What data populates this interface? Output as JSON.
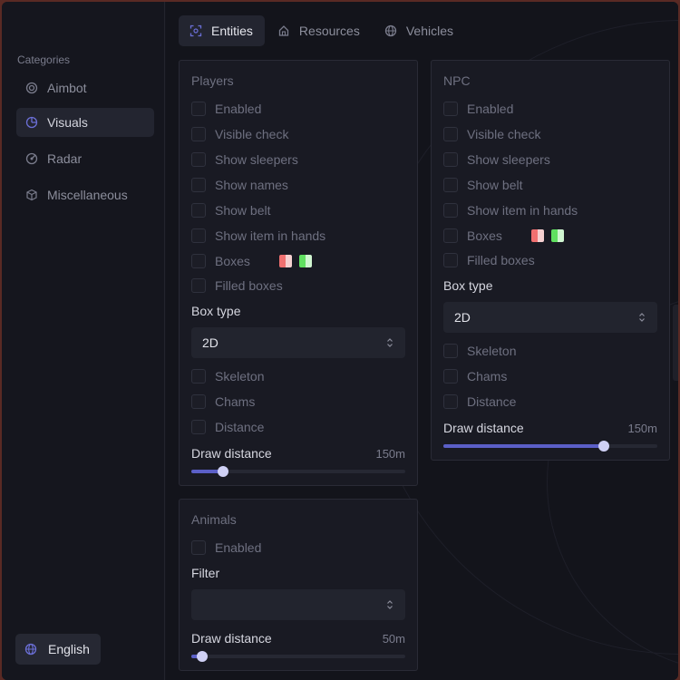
{
  "sidebar": {
    "heading": "Categories",
    "items": [
      {
        "label": "Aimbot",
        "icon": "target-icon",
        "active": false
      },
      {
        "label": "Visuals",
        "icon": "pie-chart-icon",
        "active": true
      },
      {
        "label": "Radar",
        "icon": "radar-icon",
        "active": false
      },
      {
        "label": "Miscellaneous",
        "icon": "cube-icon",
        "active": false
      }
    ],
    "language": {
      "label": "English",
      "icon": "globe-icon"
    }
  },
  "tabs": [
    {
      "label": "Entities",
      "icon": "scan-icon",
      "active": true
    },
    {
      "label": "Resources",
      "icon": "home-icon",
      "active": false
    },
    {
      "label": "Vehicles",
      "icon": "globe-icon",
      "active": false
    }
  ],
  "players": {
    "title": "Players",
    "checks_top": [
      "Enabled",
      "Visible check",
      "Show sleepers",
      "Show names",
      "Show belt",
      "Show item in hands",
      "Boxes",
      "Filled boxes"
    ],
    "box_type_label": "Box type",
    "box_type_value": "2D",
    "checks_bottom": [
      "Skeleton",
      "Chams",
      "Distance"
    ],
    "slider": {
      "label": "Draw distance",
      "value": "150m",
      "fraction": 0.15
    },
    "colors": {
      "box_color_a": "#f07070",
      "box_color_b": "#60e060"
    }
  },
  "npc": {
    "title": "NPC",
    "checks_top": [
      "Enabled",
      "Visible check",
      "Show sleepers",
      "Show belt",
      "Show item in hands",
      "Boxes",
      "Filled boxes"
    ],
    "box_type_label": "Box type",
    "box_type_value": "2D",
    "checks_bottom": [
      "Skeleton",
      "Chams",
      "Distance"
    ],
    "slider": {
      "label": "Draw distance",
      "value": "150m",
      "fraction": 0.75
    }
  },
  "animals": {
    "title": "Animals",
    "checks": [
      "Enabled"
    ],
    "filter_label": "Filter",
    "filter_value": "",
    "slider": {
      "label": "Draw distance",
      "value": "50m",
      "fraction": 0.05
    }
  },
  "theme": {
    "accent": "#5b5fc7",
    "thumb": "#cfd0f5"
  }
}
